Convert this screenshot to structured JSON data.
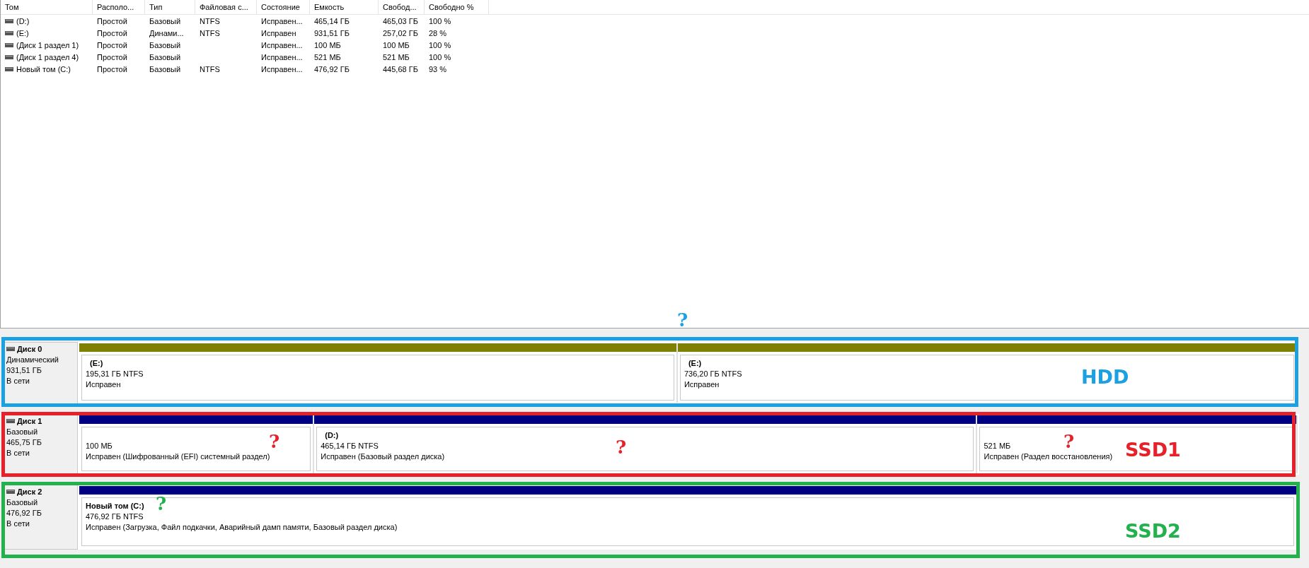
{
  "volume_table": {
    "columns": [
      "Том",
      "Располо...",
      "Тип",
      "Файловая с...",
      "Состояние",
      "Емкость",
      "Свобод...",
      "Свободно %"
    ],
    "rows": [
      {
        "cells": [
          "(D:)",
          "Простой",
          "Базовый",
          "NTFS",
          "Исправен...",
          "465,14 ГБ",
          "465,03 ГБ",
          "100 %"
        ]
      },
      {
        "cells": [
          "(E:)",
          "Простой",
          "Динами...",
          "NTFS",
          "Исправен",
          "931,51 ГБ",
          "257,02 ГБ",
          "28 %"
        ]
      },
      {
        "cells": [
          "(Диск 1 раздел 1)",
          "Простой",
          "Базовый",
          "",
          "Исправен...",
          "100 МБ",
          "100 МБ",
          "100 %"
        ]
      },
      {
        "cells": [
          "(Диск 1 раздел 4)",
          "Простой",
          "Базовый",
          "",
          "Исправен...",
          "521 МБ",
          "521 МБ",
          "100 %"
        ]
      },
      {
        "cells": [
          "Новый том (C:)",
          "Простой",
          "Базовый",
          "NTFS",
          "Исправен...",
          "476,92 ГБ",
          "445,68 ГБ",
          "93 %"
        ]
      }
    ]
  },
  "disks": [
    {
      "name": "Диск 0",
      "type": "Динамический",
      "size": "931,51 ГБ",
      "status": "В сети",
      "partitions": [
        {
          "name": "(E:)",
          "size": "195,31 ГБ NTFS",
          "status": "Исправен",
          "color": "#808000"
        },
        {
          "name": "(E:)",
          "size": "736,20 ГБ NTFS",
          "status": "Исправен",
          "color": "#808000"
        }
      ]
    },
    {
      "name": "Диск 1",
      "type": "Базовый",
      "size": "465,75 ГБ",
      "status": "В сети",
      "partitions": [
        {
          "size": "100 МБ",
          "status": "Исправен (Шифрованный (EFI) системный раздел)",
          "color": "#000080"
        },
        {
          "name": "(D:)",
          "size": "465,14 ГБ NTFS",
          "status": "Исправен (Базовый раздел диска)",
          "color": "#000080"
        },
        {
          "size": "521 МБ",
          "status": "Исправен (Раздел восстановления)",
          "color": "#000080"
        }
      ]
    },
    {
      "name": "Диск 2",
      "type": "Базовый",
      "size": "476,92 ГБ",
      "status": "В сети",
      "partitions": [
        {
          "name": "Новый том  (C:)",
          "size": "476,92 ГБ NTFS",
          "status": "Исправен (Загрузка, Файл подкачки, Аварийный дамп памяти, Базовый раздел диска)",
          "color": "#000080"
        }
      ]
    }
  ],
  "annotations": {
    "frames": [
      {
        "label": "HDD",
        "color": "#1ba1e2"
      },
      {
        "label": "SSD1",
        "color": "#e8202a"
      },
      {
        "label": "SSD2",
        "color": "#22b14c"
      }
    ],
    "question_marks": [
      {
        "text": "?",
        "color": "#1ba1e2"
      },
      {
        "text": "?",
        "color": "#e8202a"
      },
      {
        "text": "?",
        "color": "#e8202a"
      },
      {
        "text": "?",
        "color": "#e8202a"
      },
      {
        "text": "?",
        "color": "#22b14c"
      }
    ]
  }
}
